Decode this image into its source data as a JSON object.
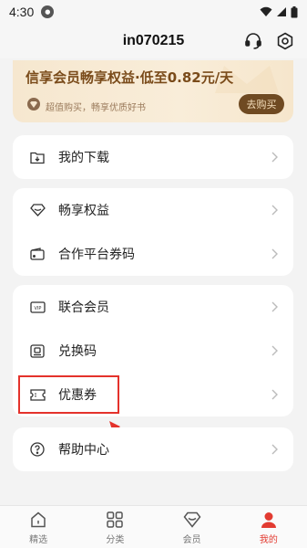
{
  "status_bar": {
    "time": "4:30",
    "icons": [
      "wifi-icon",
      "signal-icon",
      "battery-icon"
    ]
  },
  "header": {
    "title": "in070215",
    "icons": [
      "headset-icon",
      "settings-icon"
    ]
  },
  "vip_banner": {
    "title": "信享会员畅享权益·低至0.82元/天",
    "subtitle": "超值购买，畅享优质好书",
    "buy_label": "去购买"
  },
  "menu": {
    "download": {
      "label": "我的下载",
      "icon": "download-folder-icon"
    },
    "benefits": {
      "label": "畅享权益",
      "icon": "diamond-icon"
    },
    "partner_code": {
      "label": "合作平台券码",
      "icon": "wallet-icon"
    },
    "joint_member": {
      "label": "联合会员",
      "icon": "vip-card-icon"
    },
    "redeem_code": {
      "label": "兑换码",
      "icon": "redeem-icon"
    },
    "coupon": {
      "label": "优惠券",
      "icon": "ticket-icon"
    },
    "help": {
      "label": "帮助中心",
      "icon": "help-icon"
    }
  },
  "tabbar": {
    "tabs": [
      {
        "label": "精选",
        "icon": "home-icon",
        "active": false
      },
      {
        "label": "分类",
        "icon": "grid-icon",
        "active": false
      },
      {
        "label": "会员",
        "icon": "diamond-icon",
        "active": false
      },
      {
        "label": "我的",
        "icon": "person-icon",
        "active": true
      }
    ]
  },
  "colors": {
    "accent": "#e23b31",
    "vip_text": "#7a4b1a",
    "vip_button": "#6f4a22",
    "highlight": "#e4322b"
  }
}
